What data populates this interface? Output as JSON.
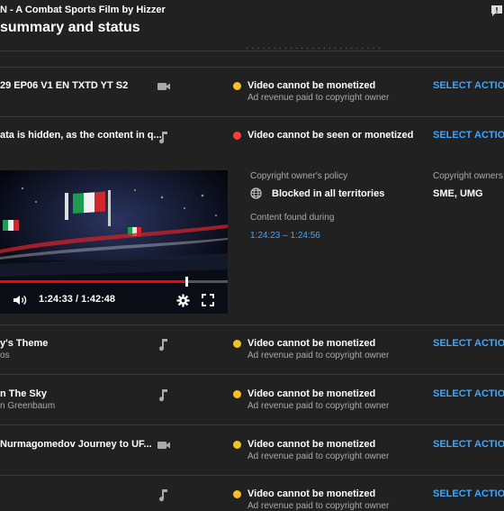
{
  "header": {
    "subtitle": "N - A Combat Sports Film by Hizzer",
    "title": "summary and status",
    "cutoff_text": "· · · · · · · · · · · · · · · · · · · · · · · · ·"
  },
  "rows": [
    {
      "title": "29 EP06 V1 EN TXTD YT S2",
      "subtitle": "",
      "type_icon": "video-camera-icon",
      "status_color": "#f6c026",
      "status": "Video cannot be monetized",
      "status_sub": "Ad revenue paid to copyright owner",
      "action": "SELECT ACTION"
    },
    {
      "title": "ata is hidden, as the content in q...",
      "subtitle": "",
      "type_icon": "music-note-icon",
      "status_color": "#ff3b3b",
      "status": "Video cannot be seen or monetized",
      "status_sub": "",
      "action": "SELECT ACTION"
    },
    {
      "title": "y's Theme",
      "subtitle": "os",
      "type_icon": "music-note-icon",
      "status_color": "#f6c026",
      "status": "Video cannot be monetized",
      "status_sub": "Ad revenue paid to copyright owner",
      "action": "SELECT ACTION"
    },
    {
      "title": "n The Sky",
      "subtitle": "n Greenbaum",
      "type_icon": "music-note-icon",
      "status_color": "#f6c026",
      "status": "Video cannot be monetized",
      "status_sub": "Ad revenue paid to copyright owner",
      "action": "SELECT ACTION"
    },
    {
      "title": " Nurmagomedov Journey to UF...",
      "subtitle": "",
      "type_icon": "video-camera-icon",
      "status_color": "#f6c026",
      "status": "Video cannot be monetized",
      "status_sub": "Ad revenue paid to copyright owner",
      "action": "SELECT ACTION"
    },
    {
      "title": "",
      "subtitle": "",
      "type_icon": "music-note-icon",
      "status_color": "#f6c026",
      "status": "Video cannot be monetized",
      "status_sub": "Ad revenue paid to copyright owner",
      "action": "SELECT ACTION"
    }
  ],
  "details": {
    "policy_label": "Copyright owner's policy",
    "policy_value": "Blocked in all territories",
    "owners_label": "Copyright owners",
    "owners_value": "SME, UMG",
    "found_label": "Content found during",
    "found_value": "1:24:23 – 1:24:56"
  },
  "player": {
    "time": "1:24:33 / 1:42:48",
    "progress": 0.82,
    "progress_color": "#ff0000"
  }
}
